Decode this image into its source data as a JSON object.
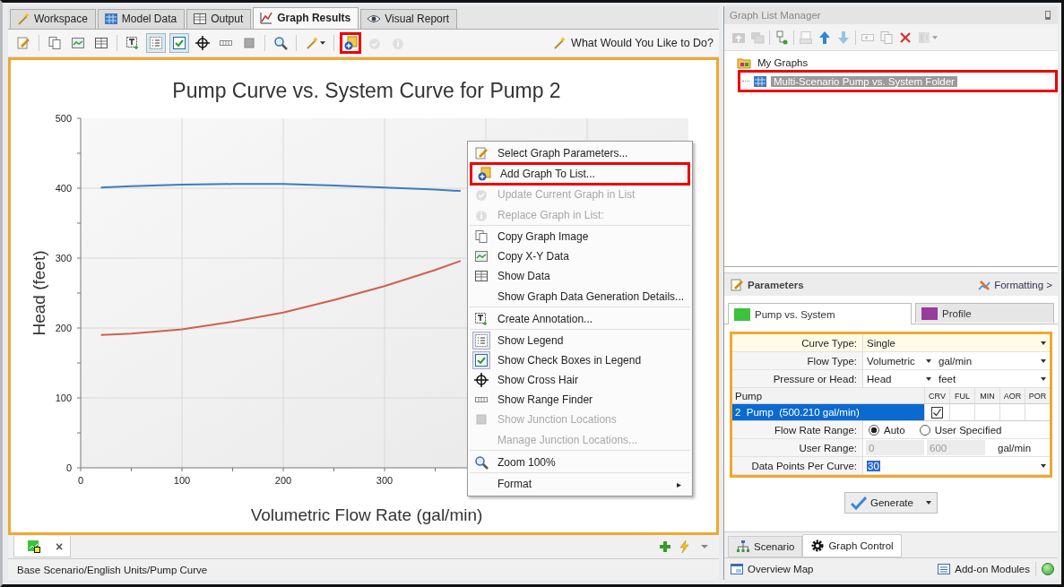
{
  "tabs": [
    {
      "label": "Workspace",
      "selected": false
    },
    {
      "label": "Model Data",
      "selected": false
    },
    {
      "label": "Output",
      "selected": false
    },
    {
      "label": "Graph Results",
      "selected": true
    },
    {
      "label": "Visual Report",
      "selected": false
    }
  ],
  "toolbar": {
    "buttons": [
      {
        "pressed": false,
        "disabled": false,
        "highlighted": false
      },
      {
        "pressed": false,
        "disabled": false,
        "highlighted": false
      },
      {
        "pressed": false,
        "disabled": false,
        "highlighted": false
      },
      {
        "pressed": false,
        "disabled": false,
        "highlighted": false
      },
      {
        "pressed": false,
        "disabled": false,
        "highlighted": false
      },
      {
        "pressed": true,
        "disabled": false,
        "highlighted": false
      },
      {
        "pressed": true,
        "disabled": false,
        "highlighted": false
      },
      {
        "pressed": false,
        "disabled": false,
        "highlighted": false
      },
      {
        "pressed": false,
        "disabled": false,
        "highlighted": false
      },
      {
        "pressed": false,
        "disabled": false,
        "highlighted": false
      },
      {
        "pressed": false,
        "disabled": false,
        "highlighted": false
      },
      {
        "pressed": false,
        "disabled": false,
        "highlighted": false
      },
      {
        "pressed": false,
        "disabled": false,
        "highlighted": true
      },
      {
        "pressed": false,
        "disabled": true,
        "highlighted": false
      },
      {
        "pressed": false,
        "disabled": true,
        "highlighted": false
      }
    ],
    "help": "What Would You Like to Do?"
  },
  "chart": {
    "chart_data": {
      "type": "line",
      "title": "Pump Curve vs. System Curve for Pump 2",
      "xlabel": "Volumetric Flow Rate (gal/min)",
      "ylabel": "Head (feet)",
      "x": [
        20,
        50,
        100,
        150,
        200,
        250,
        300,
        350,
        375
      ],
      "series": [
        {
          "color": "#3a7dc0",
          "values": [
            401,
            403,
            405,
            406,
            406,
            404,
            401,
            398,
            396
          ]
        },
        {
          "color": "#d0604a",
          "values": [
            190,
            192,
            198,
            209,
            222,
            240,
            260,
            283,
            296
          ]
        }
      ],
      "xlim": [
        0,
        600
      ],
      "ylim": [
        0,
        500
      ],
      "xticks": [
        0,
        100,
        200,
        300
      ],
      "yticks": [
        0,
        100,
        200,
        300,
        400,
        500
      ],
      "grid": true
    }
  },
  "context_menu": {
    "items": [
      {
        "label": "Select Graph Parameters...",
        "disabled": false,
        "highlighted": false,
        "checked": false,
        "separator_after": false
      },
      {
        "label": "Add Graph To List...",
        "disabled": false,
        "highlighted": true,
        "checked": false,
        "separator_after": false
      },
      {
        "label": "Update Current Graph in List",
        "disabled": true,
        "highlighted": false,
        "checked": false,
        "separator_after": false
      },
      {
        "label": "Replace Graph in List:",
        "disabled": true,
        "highlighted": false,
        "checked": false,
        "separator_after": true
      },
      {
        "label": "Copy Graph Image",
        "disabled": false,
        "highlighted": false,
        "checked": false,
        "separator_after": false
      },
      {
        "label": "Copy X-Y Data",
        "disabled": false,
        "highlighted": false,
        "checked": false,
        "separator_after": false
      },
      {
        "label": "Show Data",
        "disabled": false,
        "highlighted": false,
        "checked": false,
        "separator_after": false
      },
      {
        "label": "Show Graph Data Generation Details...",
        "disabled": false,
        "highlighted": false,
        "checked": false,
        "separator_after": true
      },
      {
        "label": "Create Annotation...",
        "disabled": false,
        "highlighted": false,
        "checked": false,
        "separator_after": true
      },
      {
        "label": "Show Legend",
        "disabled": false,
        "highlighted": false,
        "checked": true,
        "separator_after": false
      },
      {
        "label": "Show Check Boxes in Legend",
        "disabled": false,
        "highlighted": false,
        "checked": true,
        "separator_after": false
      },
      {
        "label": "Show Cross Hair",
        "disabled": false,
        "highlighted": false,
        "checked": false,
        "separator_after": false
      },
      {
        "label": "Show Range Finder",
        "disabled": false,
        "highlighted": false,
        "checked": false,
        "separator_after": false
      },
      {
        "label": "Show Junction Locations",
        "disabled": true,
        "highlighted": false,
        "checked": false,
        "separator_after": false
      },
      {
        "label": "Manage Junction Locations...",
        "disabled": true,
        "highlighted": false,
        "checked": false,
        "separator_after": true
      },
      {
        "label": "Zoom 100%",
        "disabled": false,
        "highlighted": false,
        "checked": false,
        "separator_after": true
      },
      {
        "label": "Format",
        "submenu": "▸",
        "disabled": false,
        "highlighted": false,
        "checked": false,
        "separator_after": false
      }
    ]
  },
  "graph_tabs": {
    "close": "×"
  },
  "status_bar": "Base Scenario/English Units/Pump Curve",
  "graph_list_manager": {
    "title": "Graph List Manager",
    "toolbar": [
      {
        "disabled": true
      },
      {
        "disabled": true
      },
      {
        "disabled": false
      },
      {
        "disabled": true
      },
      {
        "disabled": false
      },
      {
        "disabled": true
      },
      {
        "disabled": true
      },
      {
        "disabled": true
      },
      {
        "disabled": false
      },
      {
        "disabled": true
      }
    ],
    "tree": [
      {
        "label": "My Graphs",
        "selected": false,
        "highlighted": false,
        "children": [
          {
            "label": "Multi-Scenario Pump vs. System Folder",
            "selected": true,
            "highlighted": true
          }
        ]
      }
    ]
  },
  "parameters": {
    "title": "Parameters",
    "formatting": "Formatting >",
    "tabs": [
      {
        "label": "Pump vs. System",
        "color": "#3cc23c",
        "selected": true
      },
      {
        "label": "Profile",
        "color": "#9a3c9a",
        "selected": false
      }
    ],
    "rows": [
      {
        "kind": "select",
        "label": "Curve Type:",
        "value": "Single",
        "focused": true,
        "text_selected": false
      },
      {
        "kind": "select-pair",
        "label": "Flow Type:",
        "value": "Volumetric",
        "unit": "gal/min"
      },
      {
        "kind": "select-pair",
        "label": "Pressure or Head:",
        "value": "Head",
        "unit": "feet"
      },
      {
        "kind": "table",
        "columns": [
          "Pump",
          "CRV",
          "FUL",
          "MIN",
          "AOR",
          "POR"
        ],
        "rows": [
          {
            "name": "2  Pump  (500.210 gal/min)",
            "selected": true,
            "checks": [
              true,
              false,
              false,
              false,
              false
            ]
          }
        ]
      },
      {
        "kind": "radio",
        "label": "Flow Rate Range:",
        "options": [
          {
            "label": "Auto",
            "selected": true
          },
          {
            "label": "User Specified",
            "selected": false
          }
        ]
      },
      {
        "kind": "range",
        "label": "User Range:",
        "min": "0",
        "max": "600",
        "unit": "gal/min",
        "disabled": true
      },
      {
        "kind": "select",
        "label": "Data Points Per Curve:",
        "value": "30",
        "focused": false,
        "text_selected": true
      }
    ],
    "generate": "Generate"
  },
  "bottom_tabs": [
    {
      "label": "Scenario",
      "selected": false
    },
    {
      "label": "Graph Control",
      "selected": true
    }
  ],
  "right_status": {
    "overview": "Overview Map",
    "addons": "Add-on Modules"
  }
}
